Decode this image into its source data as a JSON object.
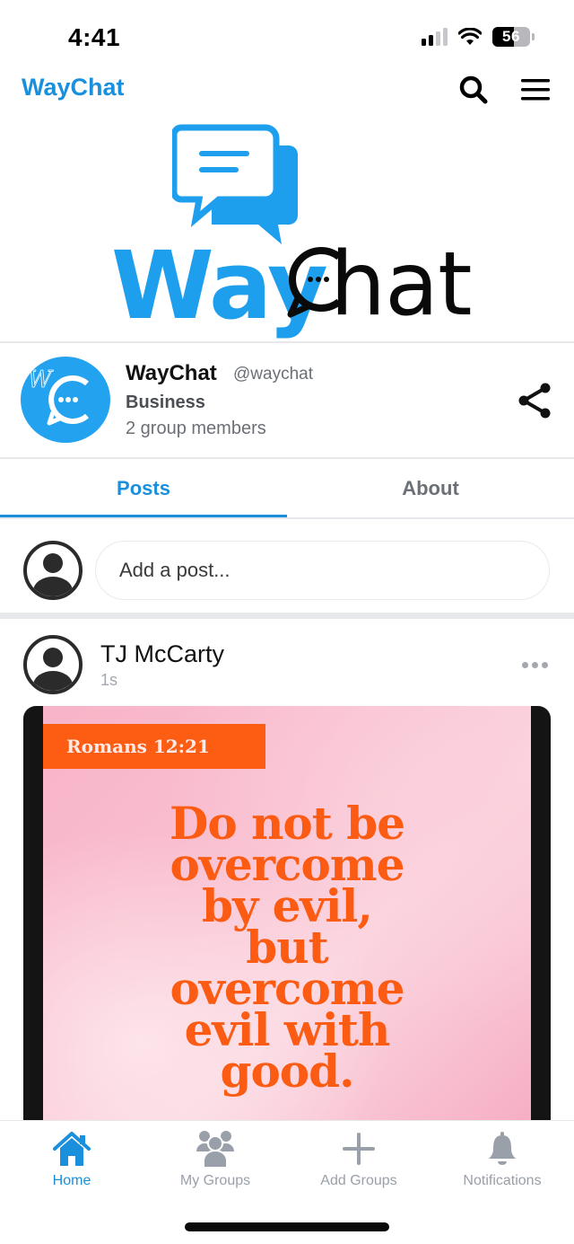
{
  "status_bar": {
    "time": "4:41",
    "battery_level": "56",
    "battery_fraction": 0.56,
    "signal_bars_active": 2,
    "signal_bars_total": 4
  },
  "header": {
    "app_title": "WayChat",
    "search_icon": "search-icon",
    "menu_icon": "hamburger-menu-icon"
  },
  "banner": {
    "logo_word_1": "Way",
    "logo_word_2": "hat",
    "brand_color": "#1e9fee"
  },
  "group": {
    "name": "WayChat",
    "handle": "@waychat",
    "category": "Business",
    "members": "2 group members",
    "avatar_letter": "W",
    "share_icon": "share-icon"
  },
  "tabs": [
    {
      "label": "Posts",
      "active": true
    },
    {
      "label": "About",
      "active": false
    }
  ],
  "composer": {
    "placeholder": "Add a post..."
  },
  "post": {
    "author": "TJ McCarty",
    "time": "1s",
    "image": {
      "reference": "Romans 12:21",
      "lines": [
        "Do not be",
        "overcome",
        "by evil,",
        "but",
        "overcome",
        "evil with",
        "good."
      ]
    }
  },
  "bottom_nav": [
    {
      "label": "Home",
      "icon": "home-icon",
      "active": true
    },
    {
      "label": "My Groups",
      "icon": "groups-icon",
      "active": false
    },
    {
      "label": "Add Groups",
      "icon": "plus-icon",
      "active": false
    },
    {
      "label": "Notifications",
      "icon": "bell-icon",
      "active": false
    }
  ],
  "colors": {
    "accent": "#1a8fdc",
    "inactive": "#9aa0a9",
    "verse_orange": "#fb5b12"
  }
}
